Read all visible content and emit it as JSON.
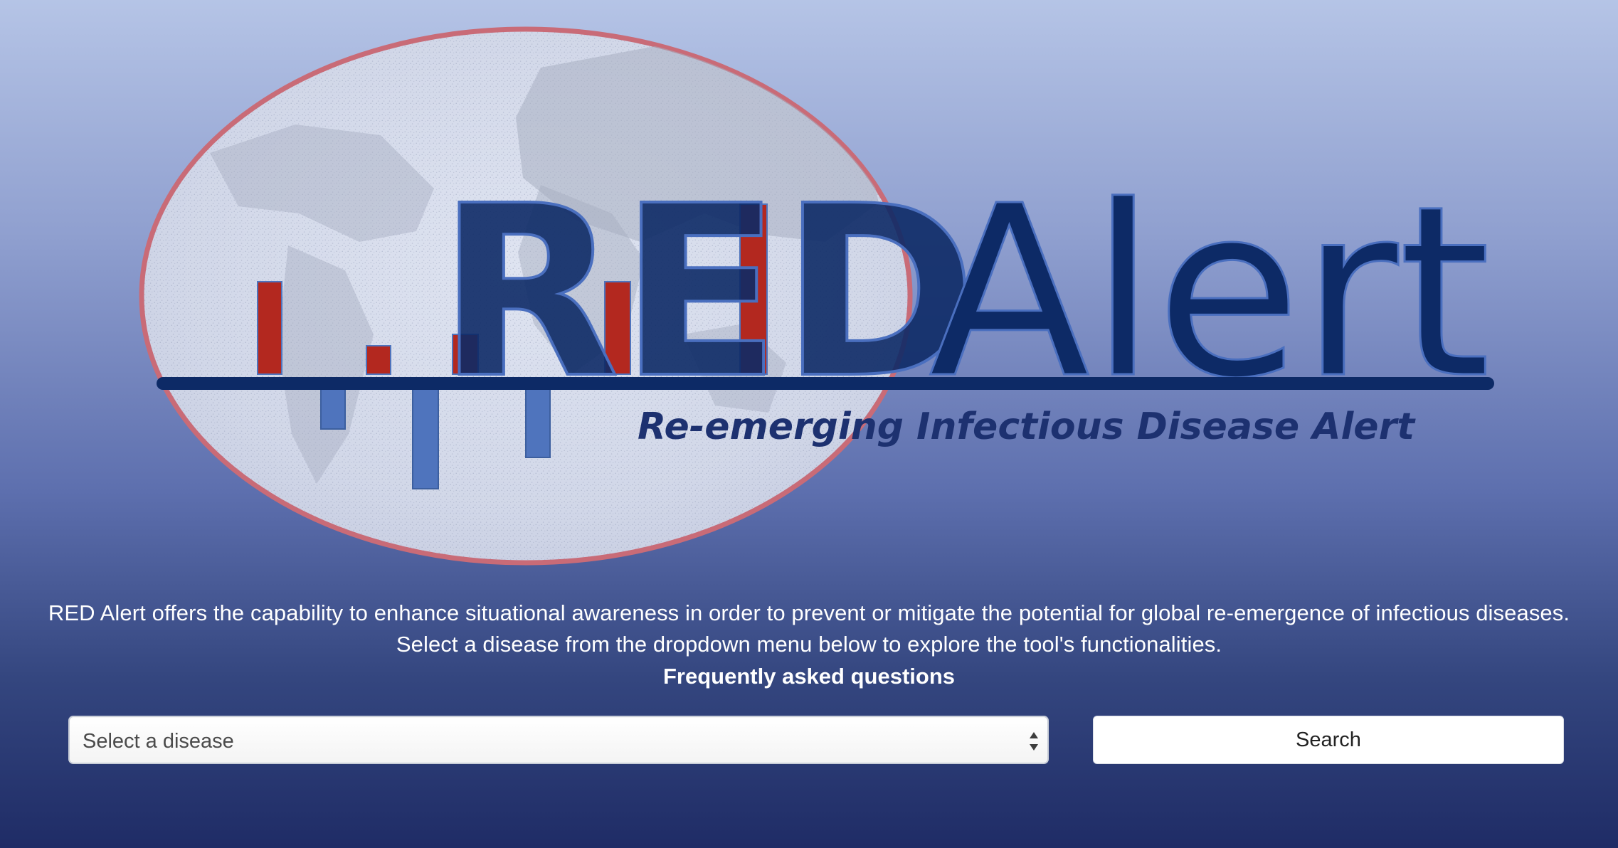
{
  "logo": {
    "title_part_1": "RED",
    "title_part_2": "Alert",
    "subtitle": "Re-emerging Infectious Disease Alert"
  },
  "intro": {
    "description": "RED Alert offers the capability to enhance situational awareness in order to prevent or mitigate the potential for global re-emergence of infectious diseases. Select a disease from the dropdown menu below to explore the tool's functionalities.",
    "faq_label": "Frequently asked questions"
  },
  "controls": {
    "disease_select_value": "Select a disease",
    "search_label": "Search"
  },
  "colors": {
    "navy": "#0d2a66",
    "red": "#b3281f",
    "blue": "#4f74bd",
    "ring": "#c7616d"
  },
  "icons": {
    "select": "select-arrows-icon"
  }
}
